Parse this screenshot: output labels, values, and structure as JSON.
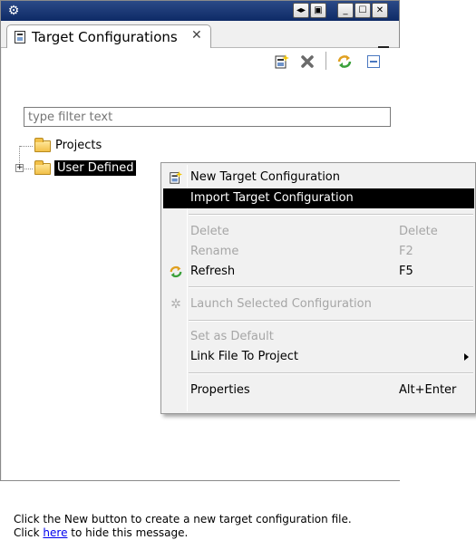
{
  "view": {
    "tab_title": "Target Configurations",
    "filter_placeholder": "type filter text"
  },
  "tree": {
    "items": [
      {
        "label": "Projects"
      },
      {
        "label": "User Defined"
      }
    ]
  },
  "hint": {
    "line1": "Click the New button to create a new target configuration file.",
    "line2_prefix": "Click ",
    "line2_link": "here",
    "line2_suffix": " to hide this message."
  },
  "context_menu": {
    "items": [
      {
        "label": "New Target Configuration",
        "accelerator": "",
        "enabled": true
      },
      {
        "label": "Import Target Configuration",
        "accelerator": "",
        "enabled": true,
        "highlighted": true
      },
      {
        "label": "Delete",
        "accelerator": "Delete",
        "enabled": false
      },
      {
        "label": "Rename",
        "accelerator": "F2",
        "enabled": false
      },
      {
        "label": "Refresh",
        "accelerator": "F5",
        "enabled": true
      },
      {
        "label": "Launch Selected Configuration",
        "accelerator": "",
        "enabled": false
      },
      {
        "label": "Set as Default",
        "accelerator": "",
        "enabled": false
      },
      {
        "label": "Link File To Project",
        "accelerator": "",
        "enabled": true,
        "submenu": true
      },
      {
        "label": "Properties",
        "accelerator": "Alt+Enter",
        "enabled": true
      }
    ]
  },
  "icons": {
    "title": "gear-icon",
    "new_config": "new-target-config-icon",
    "delete": "delete-x-icon",
    "refresh": "refresh-icon",
    "collapse": "collapse-all-icon"
  }
}
